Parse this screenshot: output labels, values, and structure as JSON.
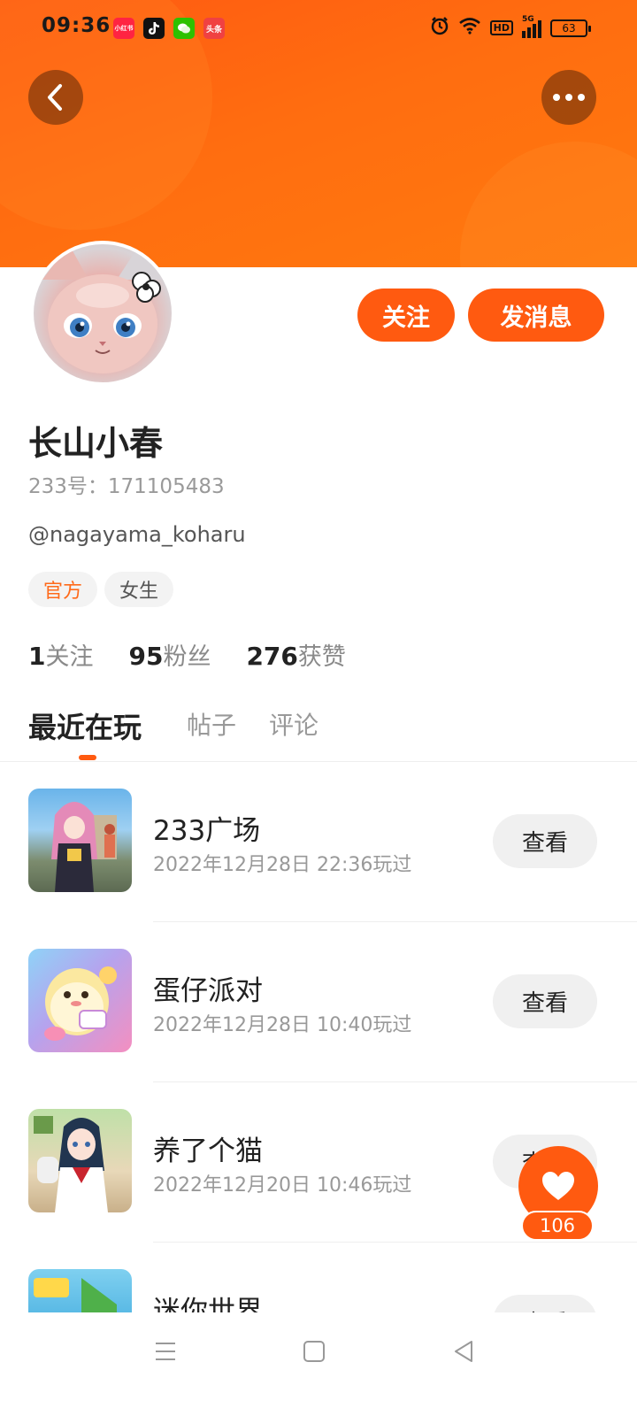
{
  "status_bar": {
    "time": "09:36",
    "apps": [
      {
        "name": "xiaohongshu-app-icon",
        "label": "小红书",
        "color": "#ff2442"
      },
      {
        "name": "tiktok-app-icon",
        "label": "",
        "color": "#111111"
      },
      {
        "name": "wechat-app-icon",
        "label": "",
        "color": "#2dc100"
      },
      {
        "name": "toutiao-app-icon",
        "label": "头条",
        "color": "#f04142"
      }
    ],
    "hd": "HD",
    "network": "5G",
    "battery": "63"
  },
  "header": {
    "back_icon": "chevron-left-icon",
    "more_icon": "more-dots-icon"
  },
  "profile": {
    "name": "长山小春",
    "uid": "233号：171105483",
    "handle": "@nagayama_koharu",
    "tags": [
      "官方",
      "女生"
    ],
    "follow_label": "关注",
    "message_label": "发消息",
    "stats": {
      "following_num": "1",
      "following_label": "关注",
      "followers_num": "95",
      "followers_label": "粉丝",
      "likes_num": "276",
      "likes_label": "获赞"
    }
  },
  "tabs": [
    "最近在玩",
    "帖子",
    "评论"
  ],
  "games": [
    {
      "name": "233广场",
      "played": "2022年12月28日 22:36玩过",
      "action": "查看"
    },
    {
      "name": "蛋仔派对",
      "played": "2022年12月28日 10:40玩过",
      "action": "查看"
    },
    {
      "name": "养了个猫",
      "played": "2022年12月20日 10:46玩过",
      "action": "查看"
    },
    {
      "name": "迷你世界",
      "played": "",
      "action": "查看"
    }
  ],
  "like_fab": {
    "count": "106"
  },
  "colors": {
    "accent": "#ff5a10",
    "banner": "#ff6d10"
  }
}
